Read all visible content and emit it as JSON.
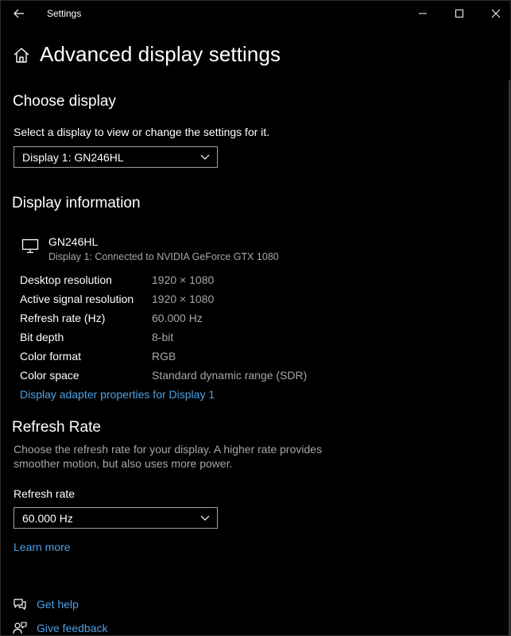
{
  "window": {
    "title": "Settings"
  },
  "page": {
    "title": "Advanced display settings"
  },
  "choose_display": {
    "heading": "Choose display",
    "description": "Select a display to view or change the settings for it.",
    "selected": "Display 1: GN246HL"
  },
  "display_info": {
    "heading": "Display information",
    "monitor_name": "GN246HL",
    "monitor_desc": "Display 1: Connected to NVIDIA GeForce GTX 1080",
    "rows": [
      {
        "label": "Desktop resolution",
        "value": "1920 × 1080"
      },
      {
        "label": "Active signal resolution",
        "value": "1920 × 1080"
      },
      {
        "label": "Refresh rate (Hz)",
        "value": "60.000 Hz"
      },
      {
        "label": "Bit depth",
        "value": "8-bit"
      },
      {
        "label": "Color format",
        "value": "RGB"
      },
      {
        "label": "Color space",
        "value": "Standard dynamic range (SDR)"
      }
    ],
    "adapter_link": "Display adapter properties for Display 1"
  },
  "refresh": {
    "heading": "Refresh Rate",
    "desc_line1": "Choose the refresh rate for your display. A higher rate provides",
    "desc_line2": "smoother motion, but also uses more power.",
    "label": "Refresh rate",
    "selected": "60.000 Hz",
    "learn_more": "Learn more"
  },
  "footer": {
    "get_help": "Get help",
    "give_feedback": "Give feedback"
  },
  "colors": {
    "accent_link": "#4ca0e6",
    "background": "#000000",
    "muted": "#a6a6a6"
  }
}
